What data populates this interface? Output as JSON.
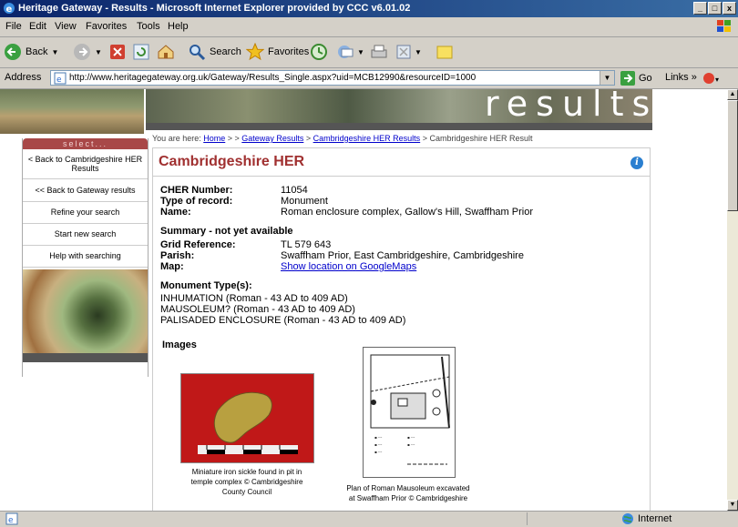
{
  "window": {
    "title": "Heritage Gateway - Results - Microsoft Internet Explorer provided by CCC v6.01.02"
  },
  "menu": [
    "File",
    "Edit",
    "View",
    "Favorites",
    "Tools",
    "Help"
  ],
  "toolbar": {
    "back": "Back",
    "search": "Search",
    "favorites": "Favorites"
  },
  "address": {
    "label": "Address",
    "url": "http://www.heritagegateway.org.uk/Gateway/Results_Single.aspx?uid=MCB12990&resourceID=1000",
    "go": "Go",
    "links": "Links"
  },
  "banner": {
    "text": "results"
  },
  "breadcrumb": {
    "prefix": "You are here:",
    "home": "Home",
    "sep1": "> >",
    "gateway": "Gateway Results",
    "sep2": ">",
    "her": "Cambridgeshire HER Results",
    "sep3": ">",
    "current": "Cambridgeshire HER Result"
  },
  "sidebar": {
    "select": "select...",
    "items": [
      "< Back to Cambridgeshire HER Results",
      "<< Back to Gateway results",
      "Refine your search",
      "Start new search",
      "Help with searching"
    ]
  },
  "record": {
    "heading": "Cambridgeshire HER",
    "cher_label": "CHER Number:",
    "cher": "11054",
    "type_label": "Type of record:",
    "type": "Monument",
    "name_label": "Name:",
    "name": "Roman enclosure complex, Gallow's Hill, Swaffham Prior",
    "summary": "Summary - not yet available",
    "grid_label": "Grid Reference:",
    "grid": "TL 579 643",
    "parish_label": "Parish:",
    "parish": "Swaffham Prior, East Cambridgeshire, Cambridgeshire",
    "map_label": "Map:",
    "map": "Show location on GoogleMaps",
    "mt_heading": "Monument Type(s):",
    "types": [
      "INHUMATION (Roman - 43 AD to 409 AD)",
      "MAUSOLEUM? (Roman - 43 AD to 409 AD)",
      "PALISADED ENCLOSURE (Roman - 43 AD to 409 AD)"
    ],
    "images_heading": "Images",
    "img1_caption": [
      "Miniature iron sickle found in pit in",
      "temple complex © Cambridgeshire",
      "County Council"
    ],
    "img2_caption": [
      "Plan of Roman Mausoleum excavated",
      "at Swaffham Prior © Cambridgeshire"
    ]
  },
  "status": {
    "zone": "Internet"
  }
}
